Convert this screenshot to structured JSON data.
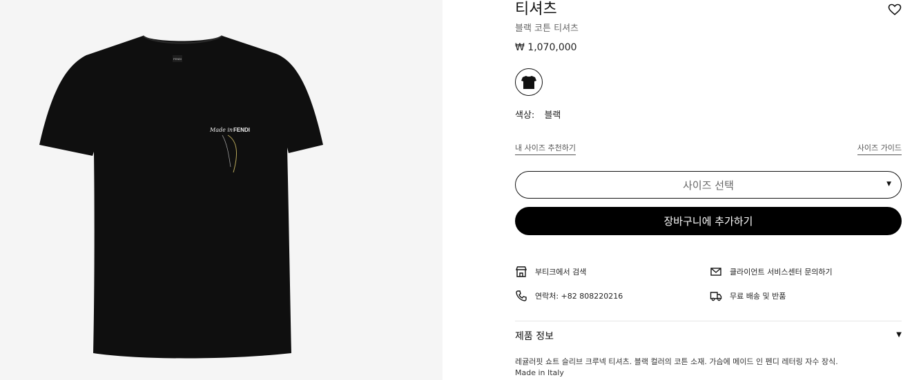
{
  "product": {
    "title": "티셔츠",
    "subtitle": "블랙 코튼 티셔츠",
    "price": "₩ 1,070,000",
    "color_label": "색상:",
    "color_value": "블랙",
    "image": {
      "background": "#f5f5f5",
      "shirt_color": "#0f0f0f",
      "neck_label": "FENDI",
      "embroidery_text_1": "Made in",
      "embroidery_text_2": "FENDI"
    }
  },
  "size": {
    "recommend_link": "내 사이즈 추천하기",
    "guide_link": "사이즈 가이드",
    "select_placeholder": "사이즈 선택"
  },
  "cart": {
    "add_label": "장바구니에 추가하기"
  },
  "services": {
    "boutique": "부티크에서 검색",
    "client_service": "클라이언트 서비스센터 문의하기",
    "contact": "연락처: +82 808220216",
    "shipping": "무료 배송 및 반품"
  },
  "details": {
    "header": "제품 정보",
    "description": "레귤러핏 쇼트 슬리브 크루넥 티셔츠. 블랙 컬러의 코튼 소재. 가슴에 메이드 인 펜디 레터링 자수 장식.",
    "origin": "Made in Italy"
  },
  "icons": {
    "wishlist": "heart-icon",
    "boutique": "store-icon",
    "client_service": "mail-icon",
    "contact": "phone-icon",
    "shipping": "truck-icon"
  },
  "colors": {
    "accent": "#000000",
    "muted_text": "#666666",
    "divider": "#e5e5e5"
  }
}
